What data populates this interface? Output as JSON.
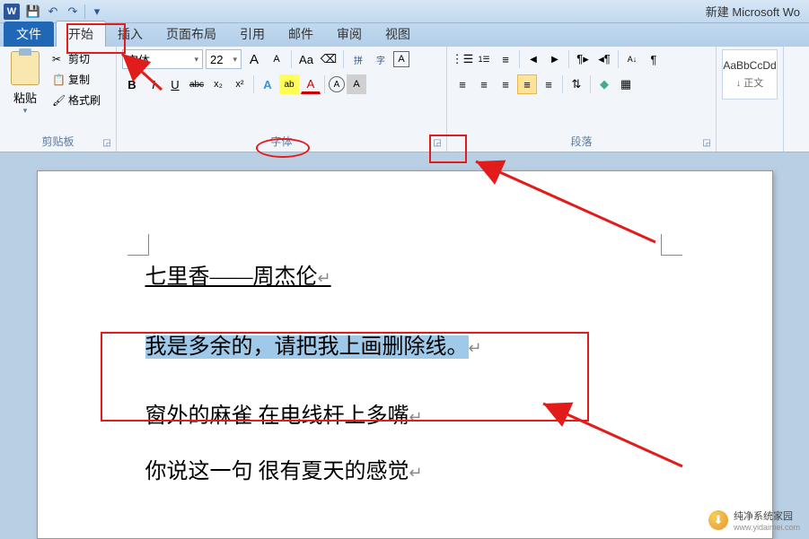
{
  "title": "新建 Microsoft Wo",
  "qat": {
    "save": "💾",
    "undo": "↶",
    "redo": "↷"
  },
  "tabs": {
    "file": "文件",
    "home": "开始",
    "insert": "插入",
    "layout": "页面布局",
    "references": "引用",
    "mailings": "邮件",
    "review": "审阅",
    "view": "视图"
  },
  "clipboard": {
    "paste": "粘贴",
    "cut": "剪切",
    "copy": "复制",
    "format_painter": "格式刷",
    "group_label": "剪贴板"
  },
  "font": {
    "name": "宋体",
    "size": "22",
    "group_label": "字体",
    "grow": "A",
    "shrink": "A",
    "change_case": "Aa",
    "clear": "⌫",
    "pinyin": "拼",
    "enclose": "字",
    "border": "A",
    "bold": "B",
    "italic": "I",
    "underline": "U",
    "strike": "abc",
    "sub": "x₂",
    "sup": "x²",
    "text_effects": "A",
    "highlight": "ab",
    "font_color": "A",
    "enclose2": "A",
    "char_shading": "A"
  },
  "paragraph": {
    "group_label": "段落",
    "bullets": "⋮☰",
    "numbering": "1☰",
    "multilevel": "≡",
    "dec_indent": "◀",
    "inc_indent": "▶",
    "sort": "A↓",
    "show_marks": "¶",
    "align_left": "≡",
    "align_center": "≡",
    "align_right": "≡",
    "justify": "≡",
    "distribute": "≡",
    "line_spacing": "⇅",
    "shading": "◆",
    "borders": "▦"
  },
  "styles": {
    "sample": "AaBbCcDd",
    "name": "↓ 正文"
  },
  "document": {
    "line1": "七里香——周杰伦",
    "line2": "我是多余的，请把我上画删除线。",
    "line3": "窗外的麻雀  在电线杆上多嘴",
    "line4": "你说这一句  很有夏天的感觉"
  },
  "watermark": {
    "text": "纯净系统家园",
    "url": "www.yidaimei.com"
  }
}
